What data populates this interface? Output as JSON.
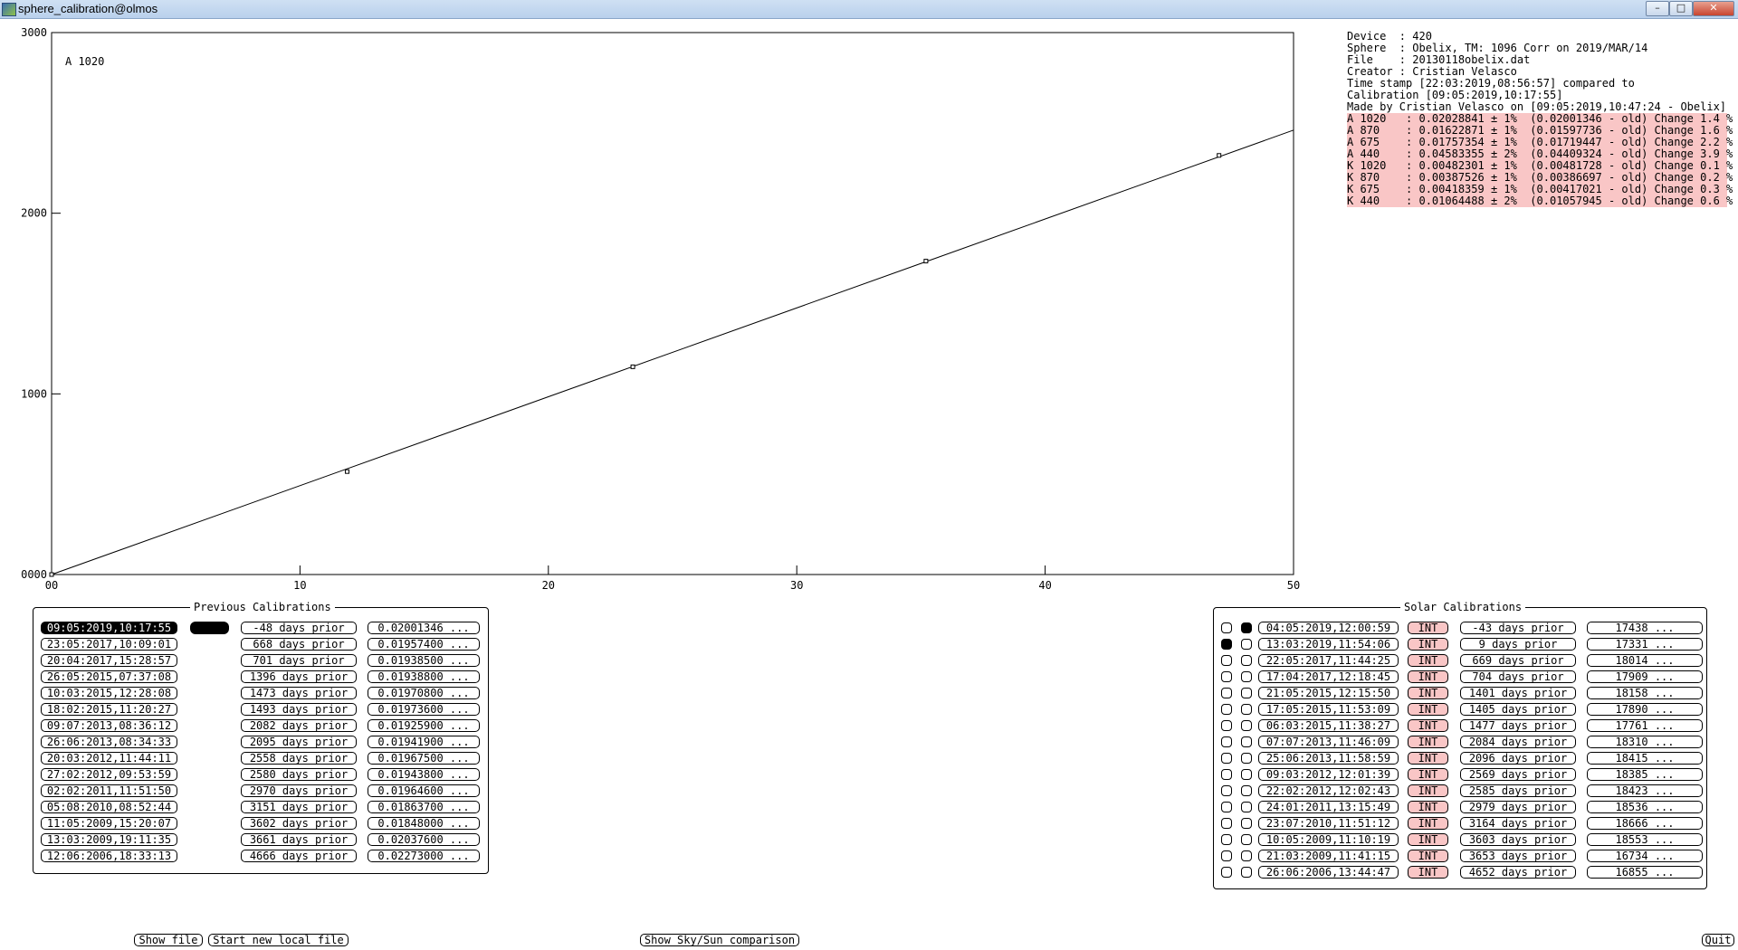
{
  "window": {
    "title": "sphere_calibration@olmos",
    "minimize": "–",
    "maximize": "□",
    "close": "✕"
  },
  "chart_data": {
    "type": "scatter",
    "label": "A 1020",
    "xlim": [
      0,
      50
    ],
    "ylim": [
      0,
      3000
    ],
    "x_ticks": [
      "00",
      "10",
      "20",
      "30",
      "40",
      "50"
    ],
    "y_ticks": [
      "0000",
      "1000",
      "2000",
      "3000"
    ],
    "points": [
      {
        "x": 0,
        "y": 0
      },
      {
        "x": 11.9,
        "y": 570
      },
      {
        "x": 23.4,
        "y": 1150
      },
      {
        "x": 35.2,
        "y": 1735
      },
      {
        "x": 47.0,
        "y": 2320
      }
    ],
    "fit_line": {
      "x0": 0,
      "y0": 0,
      "x1": 50,
      "y1": 2460
    }
  },
  "info": {
    "lines": [
      "Device  : 420",
      "Sphere  : Obelix, TM: 1096 Corr on 2019/MAR/14",
      "File    : 20130118obelix.dat",
      "Creator : Cristian Velasco",
      "Time stamp [22:03:2019,08:56:57] compared to",
      "Calibration [09:05:2019,10:17:55]",
      "Made by Cristian Velasco on [09:05:2019,10:47:24 - Obelix]"
    ],
    "coeffs": [
      "A 1020   : 0.02028841 ± 1%  (0.02001346 - old) Change 1.4 %",
      "A 870    : 0.01622871 ± 1%  (0.01597736 - old) Change 1.6 %",
      "A 675    : 0.01757354 ± 1%  (0.01719447 - old) Change 2.2 %",
      "A 440    : 0.04583355 ± 2%  (0.04409324 - old) Change 3.9 %",
      "K 1020   : 0.00482301 ± 1%  (0.00481728 - old) Change 0.1 %",
      "K 870    : 0.00387526 ± 1%  (0.00386697 - old) Change 0.2 %",
      "K 675    : 0.00418359 ± 1%  (0.00417021 - old) Change 0.3 %",
      "K 440    : 0.01064488 ± 2%  (0.01057945 - old) Change 0.6 %"
    ]
  },
  "previous": {
    "title": "Previous Calibrations",
    "rows": [
      {
        "date": "09:05:2019,10:17:55",
        "days": "-48 days prior",
        "value": "0.02001346 ...",
        "selected": true
      },
      {
        "date": "23:05:2017,10:09:01",
        "days": "668 days prior",
        "value": "0.01957400 ..."
      },
      {
        "date": "20:04:2017,15:28:57",
        "days": "701 days prior",
        "value": "0.01938500 ..."
      },
      {
        "date": "26:05:2015,07:37:08",
        "days": "1396 days prior",
        "value": "0.01938800 ..."
      },
      {
        "date": "10:03:2015,12:28:08",
        "days": "1473 days prior",
        "value": "0.01970800 ..."
      },
      {
        "date": "18:02:2015,11:20:27",
        "days": "1493 days prior",
        "value": "0.01973600 ..."
      },
      {
        "date": "09:07:2013,08:36:12",
        "days": "2082 days prior",
        "value": "0.01925900 ..."
      },
      {
        "date": "26:06:2013,08:34:33",
        "days": "2095 days prior",
        "value": "0.01941900 ..."
      },
      {
        "date": "20:03:2012,11:44:11",
        "days": "2558 days prior",
        "value": "0.01967500 ..."
      },
      {
        "date": "27:02:2012,09:53:59",
        "days": "2580 days prior",
        "value": "0.01943800 ..."
      },
      {
        "date": "02:02:2011,11:51:50",
        "days": "2970 days prior",
        "value": "0.01964600 ..."
      },
      {
        "date": "05:08:2010,08:52:44",
        "days": "3151 days prior",
        "value": "0.01863700 ..."
      },
      {
        "date": "11:05:2009,15:20:07",
        "days": "3602 days prior",
        "value": "0.01848000 ..."
      },
      {
        "date": "13:03:2009,19:11:35",
        "days": "3661 days prior",
        "value": "0.02037600 ..."
      },
      {
        "date": "12:06:2006,18:33:13",
        "days": "4666 days prior",
        "value": "0.02273000 ..."
      }
    ]
  },
  "solar": {
    "title": "Solar Calibrations",
    "int_label": "INT",
    "rows": [
      {
        "c1": false,
        "c2": true,
        "date": "04:05:2019,12:00:59",
        "days": "-43 days prior",
        "value": "17438 ..."
      },
      {
        "c1": true,
        "c2": false,
        "date": "13:03:2019,11:54:06",
        "days": "9 days prior",
        "value": "17331 ..."
      },
      {
        "c1": false,
        "c2": false,
        "date": "22:05:2017,11:44:25",
        "days": "669 days prior",
        "value": "18014 ..."
      },
      {
        "c1": false,
        "c2": false,
        "date": "17:04:2017,12:18:45",
        "days": "704 days prior",
        "value": "17909 ..."
      },
      {
        "c1": false,
        "c2": false,
        "date": "21:05:2015,12:15:50",
        "days": "1401 days prior",
        "value": "18158 ..."
      },
      {
        "c1": false,
        "c2": false,
        "date": "17:05:2015,11:53:09",
        "days": "1405 days prior",
        "value": "17890 ..."
      },
      {
        "c1": false,
        "c2": false,
        "date": "06:03:2015,11:38:27",
        "days": "1477 days prior",
        "value": "17761 ..."
      },
      {
        "c1": false,
        "c2": false,
        "date": "07:07:2013,11:46:09",
        "days": "2084 days prior",
        "value": "18310 ..."
      },
      {
        "c1": false,
        "c2": false,
        "date": "25:06:2013,11:58:59",
        "days": "2096 days prior",
        "value": "18415 ..."
      },
      {
        "c1": false,
        "c2": false,
        "date": "09:03:2012,12:01:39",
        "days": "2569 days prior",
        "value": "18385 ..."
      },
      {
        "c1": false,
        "c2": false,
        "date": "22:02:2012,12:02:43",
        "days": "2585 days prior",
        "value": "18423 ..."
      },
      {
        "c1": false,
        "c2": false,
        "date": "24:01:2011,13:15:49",
        "days": "2979 days prior",
        "value": "18536 ..."
      },
      {
        "c1": false,
        "c2": false,
        "date": "23:07:2010,11:51:12",
        "days": "3164 days prior",
        "value": "18666 ..."
      },
      {
        "c1": false,
        "c2": false,
        "date": "10:05:2009,11:10:19",
        "days": "3603 days prior",
        "value": "18553 ..."
      },
      {
        "c1": false,
        "c2": false,
        "date": "21:03:2009,11:41:15",
        "days": "3653 days prior",
        "value": "16734 ..."
      },
      {
        "c1": false,
        "c2": false,
        "date": "26:06:2006,13:44:47",
        "days": "4652 days prior",
        "value": "16855 ..."
      }
    ]
  },
  "buttons": {
    "show_file": "Show file",
    "start_new": "Start new local file",
    "show_sky": "Show Sky/Sun comparison",
    "quit": "Quit"
  }
}
